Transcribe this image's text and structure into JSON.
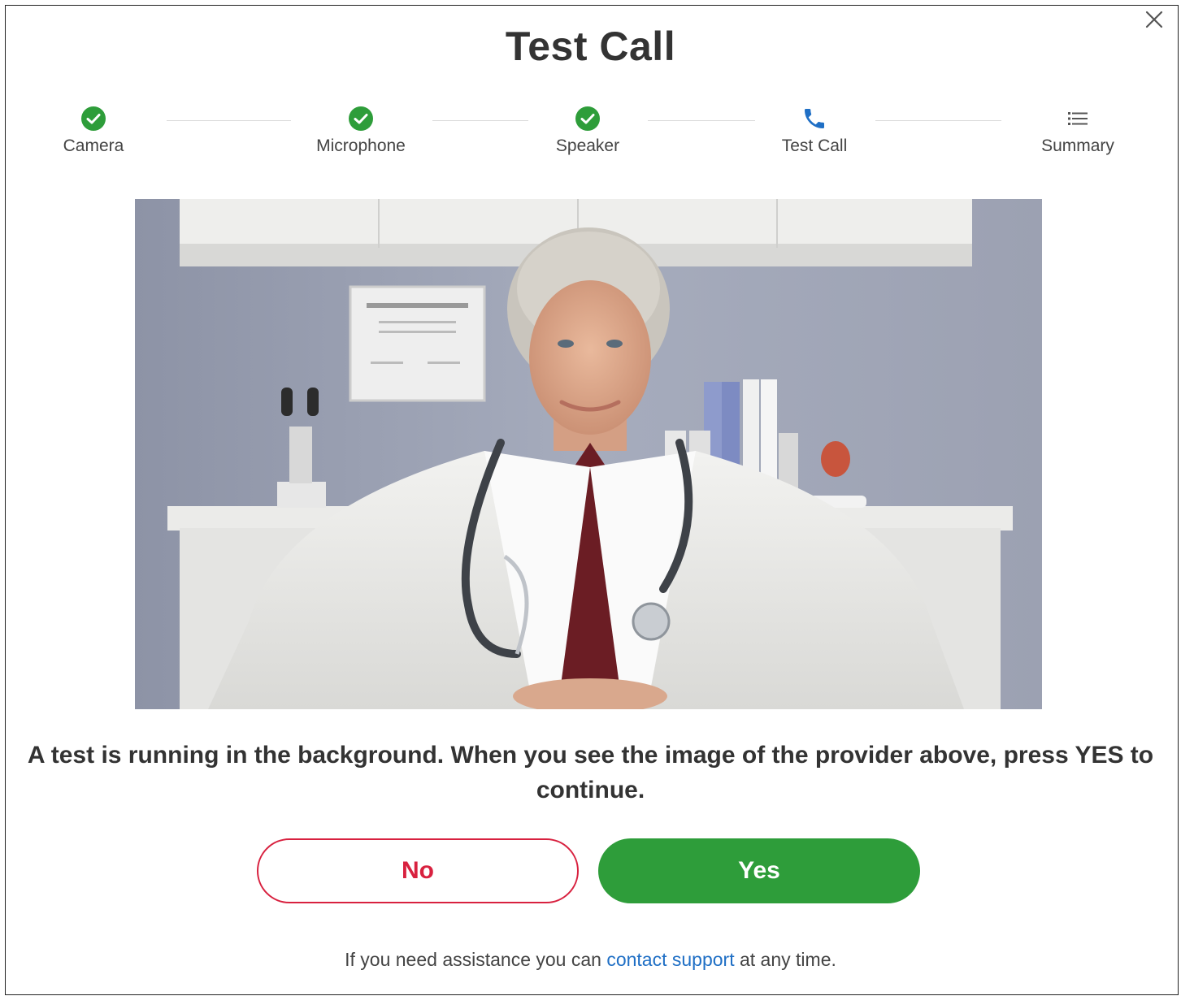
{
  "dialog": {
    "title": "Test Call"
  },
  "steps": [
    {
      "label": "Camera",
      "icon": "check-circle-icon"
    },
    {
      "label": "Microphone",
      "icon": "check-circle-icon"
    },
    {
      "label": "Speaker",
      "icon": "check-circle-icon"
    },
    {
      "label": "Test Call",
      "icon": "phone-icon"
    },
    {
      "label": "Summary",
      "icon": "list-icon"
    }
  ],
  "message": "A test is running in the background. When you see the image of the provider above, press YES to continue.",
  "buttons": {
    "no": "No",
    "yes": "Yes"
  },
  "help": {
    "prefix": "If you need assistance you can",
    "link": "contact support",
    "suffix": "at any time."
  },
  "colors": {
    "check": "#2e9d3a",
    "phone": "#1f6fc5",
    "no": "#d8213f",
    "yes": "#2e9d3a"
  }
}
